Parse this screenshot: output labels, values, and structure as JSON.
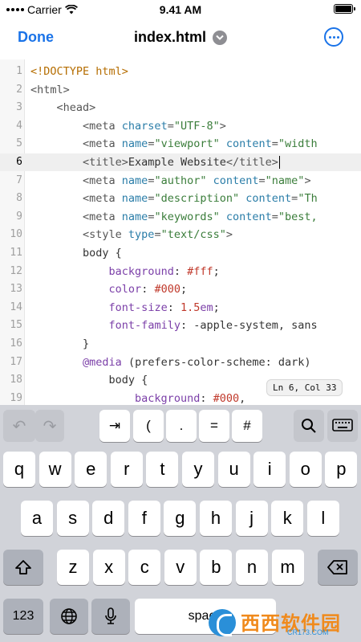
{
  "status_bar": {
    "carrier": "Carrier",
    "time": "9.41 AM"
  },
  "navbar": {
    "done_label": "Done",
    "title": "index.html"
  },
  "editor": {
    "lines": [
      {
        "n": "1",
        "tokens": [
          [
            "doctype",
            "<!DOCTYPE html>"
          ]
        ]
      },
      {
        "n": "2",
        "tokens": [
          [
            "tag",
            "<html>"
          ]
        ]
      },
      {
        "n": "3",
        "tokens": [
          [
            "tag",
            "    <head>"
          ]
        ]
      },
      {
        "n": "4",
        "tokens": [
          [
            "tag",
            "        <meta "
          ],
          [
            "attr",
            "charset"
          ],
          [
            "tag",
            "="
          ],
          [
            "val",
            "\"UTF-8\""
          ],
          [
            "tag",
            ">"
          ]
        ]
      },
      {
        "n": "5",
        "tokens": [
          [
            "tag",
            "        <meta "
          ],
          [
            "attr",
            "name"
          ],
          [
            "tag",
            "="
          ],
          [
            "val",
            "\"viewport\""
          ],
          [
            "tag",
            " "
          ],
          [
            "attr",
            "content"
          ],
          [
            "tag",
            "="
          ],
          [
            "val",
            "\"width"
          ]
        ]
      },
      {
        "n": "6",
        "tokens": [
          [
            "tag",
            "        <title>"
          ],
          [
            "plain",
            "Example Website"
          ],
          [
            "tag",
            "</title>"
          ]
        ],
        "active": true
      },
      {
        "n": "7",
        "tokens": [
          [
            "tag",
            "        <meta "
          ],
          [
            "attr",
            "name"
          ],
          [
            "tag",
            "="
          ],
          [
            "val",
            "\"author\""
          ],
          [
            "tag",
            " "
          ],
          [
            "attr",
            "content"
          ],
          [
            "tag",
            "="
          ],
          [
            "val",
            "\"name\""
          ],
          [
            "tag",
            ">"
          ]
        ]
      },
      {
        "n": "8",
        "tokens": [
          [
            "tag",
            "        <meta "
          ],
          [
            "attr",
            "name"
          ],
          [
            "tag",
            "="
          ],
          [
            "val",
            "\"description\""
          ],
          [
            "tag",
            " "
          ],
          [
            "attr",
            "content"
          ],
          [
            "tag",
            "="
          ],
          [
            "val",
            "\"Th"
          ]
        ]
      },
      {
        "n": "9",
        "tokens": [
          [
            "tag",
            "        <meta "
          ],
          [
            "attr",
            "name"
          ],
          [
            "tag",
            "="
          ],
          [
            "val",
            "\"keywords\""
          ],
          [
            "tag",
            " "
          ],
          [
            "attr",
            "content"
          ],
          [
            "tag",
            "="
          ],
          [
            "val",
            "\"best,"
          ]
        ]
      },
      {
        "n": "10",
        "tokens": [
          [
            "tag",
            "        <style "
          ],
          [
            "attr",
            "type"
          ],
          [
            "tag",
            "="
          ],
          [
            "val",
            "\"text/css\""
          ],
          [
            "tag",
            ">"
          ]
        ]
      },
      {
        "n": "11",
        "tokens": [
          [
            "plain",
            "        body {"
          ]
        ]
      },
      {
        "n": "12",
        "tokens": [
          [
            "plain",
            "            "
          ],
          [
            "prop",
            "background"
          ],
          [
            "plain",
            ": "
          ],
          [
            "num",
            "#fff"
          ],
          [
            "plain",
            ";"
          ]
        ]
      },
      {
        "n": "13",
        "tokens": [
          [
            "plain",
            "            "
          ],
          [
            "prop",
            "color"
          ],
          [
            "plain",
            ": "
          ],
          [
            "num",
            "#000"
          ],
          [
            "plain",
            ";"
          ]
        ]
      },
      {
        "n": "14",
        "tokens": [
          [
            "plain",
            "            "
          ],
          [
            "prop",
            "font-size"
          ],
          [
            "plain",
            ": "
          ],
          [
            "num",
            "1.5"
          ],
          [
            "prop",
            "em"
          ],
          [
            "plain",
            ";"
          ]
        ]
      },
      {
        "n": "15",
        "tokens": [
          [
            "plain",
            "            "
          ],
          [
            "prop",
            "font-family"
          ],
          [
            "plain",
            ": -apple-system, sans"
          ]
        ]
      },
      {
        "n": "16",
        "tokens": [
          [
            "plain",
            "        }"
          ]
        ]
      },
      {
        "n": "17",
        "tokens": [
          [
            "plain",
            "        "
          ],
          [
            "prop",
            "@media"
          ],
          [
            "plain",
            " (prefers-color-scheme: dark)"
          ]
        ]
      },
      {
        "n": "18",
        "tokens": [
          [
            "plain",
            "            body {"
          ]
        ]
      },
      {
        "n": "19",
        "tokens": [
          [
            "plain",
            "                "
          ],
          [
            "prop",
            "background"
          ],
          [
            "plain",
            ": "
          ],
          [
            "num",
            "#000"
          ],
          [
            "plain",
            ","
          ]
        ]
      }
    ],
    "cursor_tooltip": "Ln 6, Col 33"
  },
  "accessory_bar": {
    "undo_icon": "↶",
    "redo_icon": "↷",
    "keys": [
      "⇥",
      "(",
      ".",
      "=",
      "#"
    ],
    "search_icon": "search-icon",
    "keyboard_icon": "keyboard-dismiss-icon"
  },
  "keyboard": {
    "row1": [
      "q",
      "w",
      "e",
      "r",
      "t",
      "y",
      "u",
      "i",
      "o",
      "p"
    ],
    "row2": [
      "a",
      "s",
      "d",
      "f",
      "g",
      "h",
      "j",
      "k",
      "l"
    ],
    "row3": [
      "z",
      "x",
      "c",
      "v",
      "b",
      "n",
      "m"
    ],
    "numbers_label": "123",
    "space_label": "space"
  },
  "watermark": {
    "text": "西西软件园",
    "sub": "CR173.COM"
  }
}
